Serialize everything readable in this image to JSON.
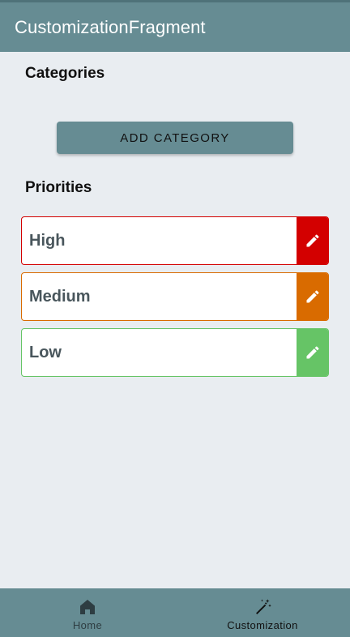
{
  "app_bar": {
    "title": "CustomizationFragment",
    "color": "#668c93"
  },
  "categories": {
    "title": "Categories",
    "add_button_label": "ADD CATEGORY"
  },
  "priorities": {
    "title": "Priorities",
    "items": [
      {
        "label": "High",
        "color": "#d30000",
        "edit_icon": "pencil-icon"
      },
      {
        "label": "Medium",
        "color": "#d96b00",
        "edit_icon": "pencil-icon"
      },
      {
        "label": "Low",
        "color": "#66c466",
        "edit_icon": "pencil-icon"
      }
    ]
  },
  "bottom_nav": {
    "items": [
      {
        "label": "Home",
        "icon": "home-icon",
        "active": false
      },
      {
        "label": "Customization",
        "icon": "magic-wand-icon",
        "active": true
      }
    ]
  }
}
